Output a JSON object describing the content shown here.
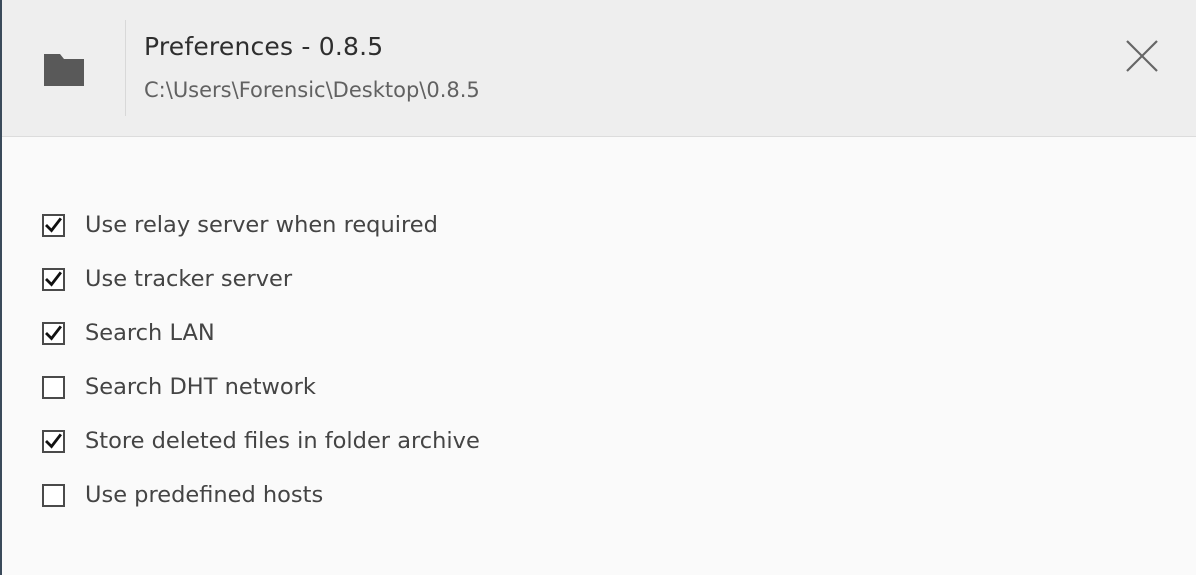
{
  "header": {
    "title": "Preferences - 0.8.5",
    "path": "C:\\Users\\Forensic\\Desktop\\0.8.5",
    "icon": "folder-icon",
    "close_icon": "close-icon"
  },
  "options": [
    {
      "label": "Use relay server when required",
      "checked": true
    },
    {
      "label": "Use tracker server",
      "checked": true
    },
    {
      "label": "Search LAN",
      "checked": true
    },
    {
      "label": "Search DHT network",
      "checked": false
    },
    {
      "label": "Store deleted files in folder archive",
      "checked": true
    },
    {
      "label": "Use predefined hosts",
      "checked": false
    }
  ]
}
